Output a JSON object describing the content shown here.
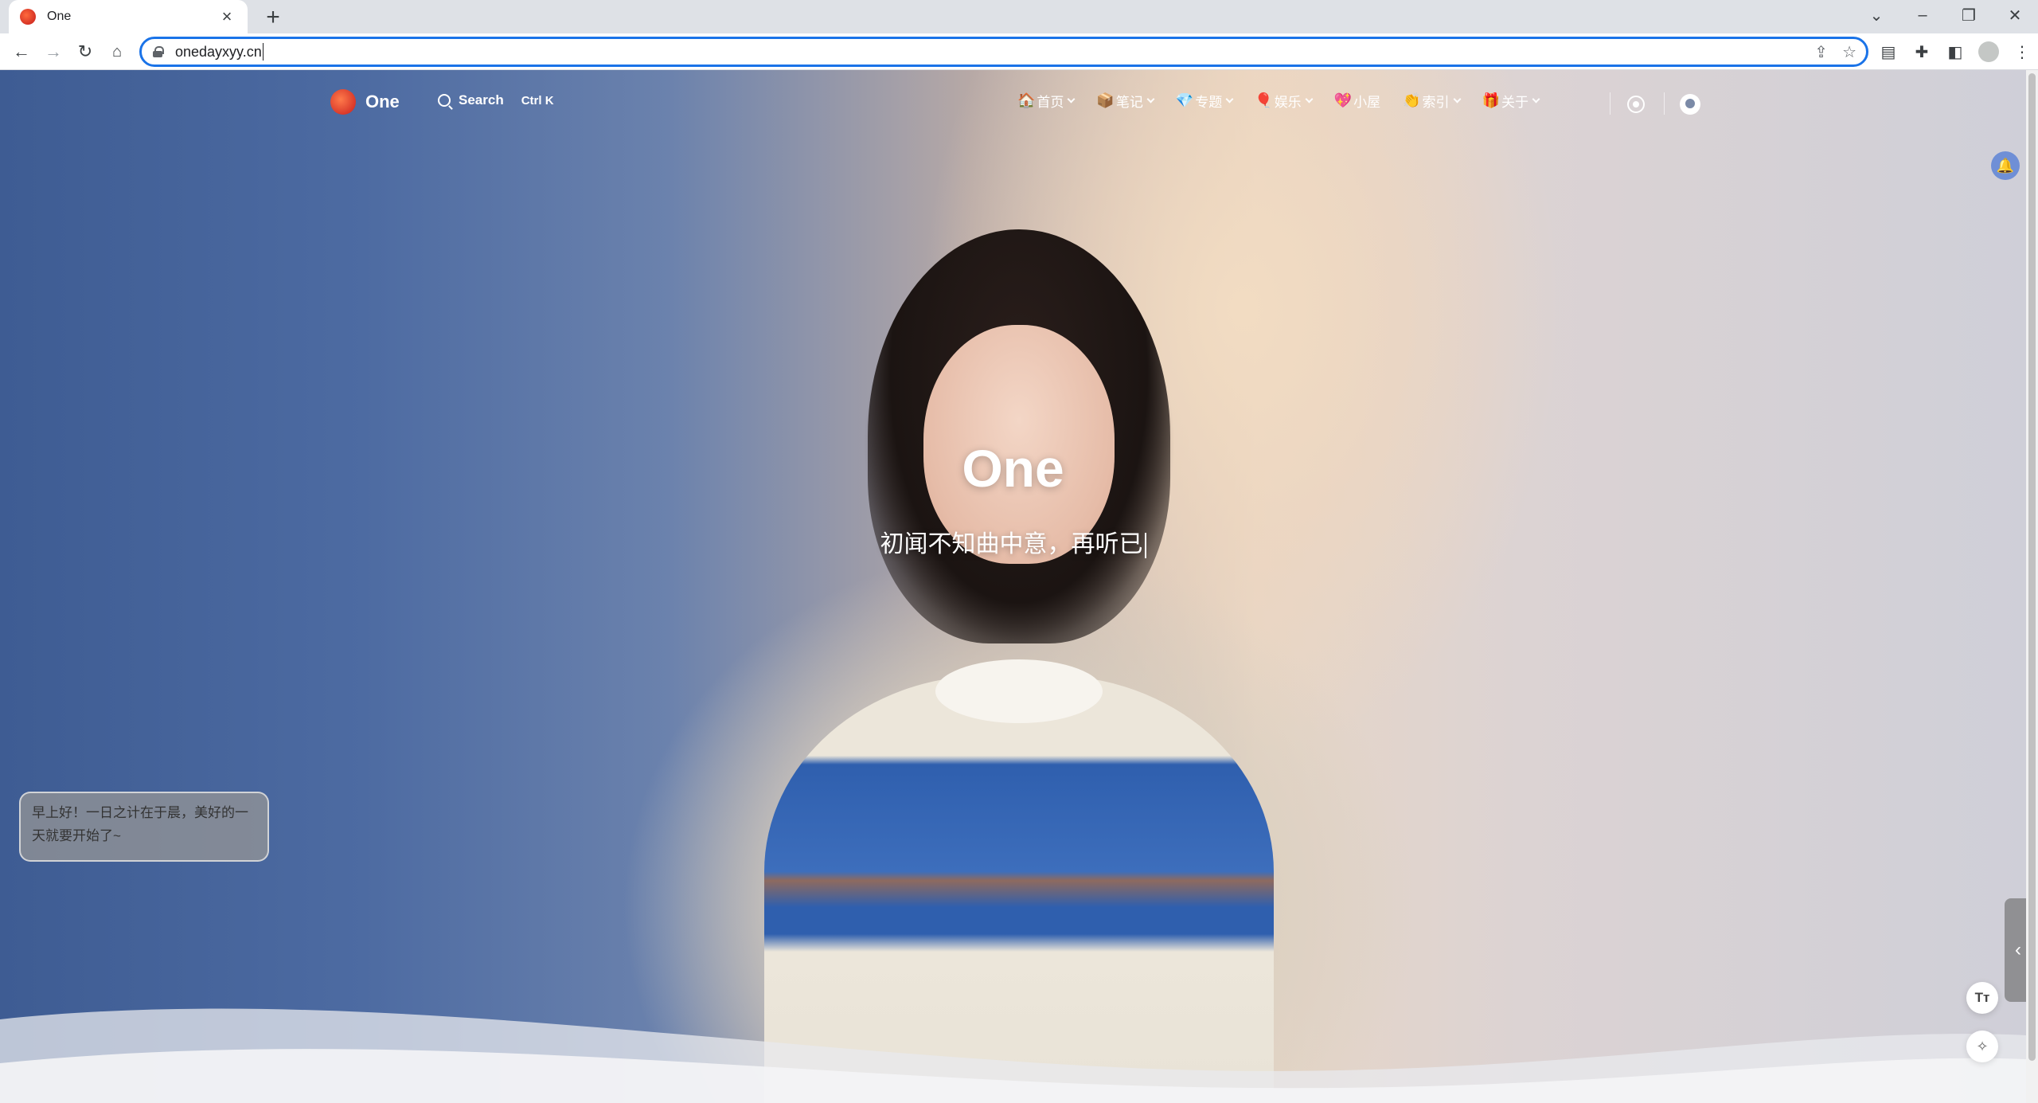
{
  "browser": {
    "tab_title": "One",
    "new_tab_symbol": "+",
    "close_symbol": "×",
    "url": "onedayxyy.cn",
    "window_controls": [
      "⌄",
      "–",
      "❐",
      "✕"
    ]
  },
  "site": {
    "brand": "One",
    "search_label": "Search",
    "search_shortcut": "Ctrl K",
    "menu": [
      {
        "emoji": "🏠",
        "label": "首页",
        "dropdown": true
      },
      {
        "emoji": "📦",
        "label": "笔记",
        "dropdown": true
      },
      {
        "emoji": "💎",
        "label": "专题",
        "dropdown": true
      },
      {
        "emoji": "🎈",
        "label": "娱乐",
        "dropdown": true
      },
      {
        "emoji": "💖",
        "label": "小屋",
        "dropdown": false
      },
      {
        "emoji": "👏",
        "label": "索引",
        "dropdown": true
      },
      {
        "emoji": "🎁",
        "label": "关于",
        "dropdown": true
      }
    ]
  },
  "hero": {
    "title": "One",
    "subtitle": "初闻不知曲中意，再听已"
  },
  "toast": {
    "message": "早上好！一日之计在于晨，美好的一天就要开始了~"
  },
  "tools": {
    "font_button": "Tт",
    "side_tab_symbol": "‹",
    "bell_symbol": "🔔"
  },
  "colors": {
    "accent": "#1a73e8",
    "bell_bg": "#6f8fd6"
  }
}
